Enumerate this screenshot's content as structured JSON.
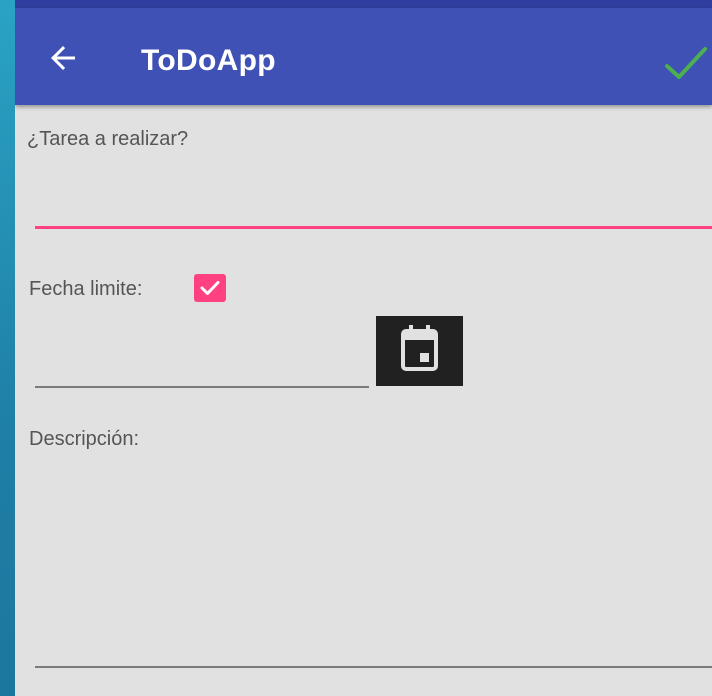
{
  "toolbar": {
    "title": "ToDoApp",
    "back_icon": "arrow-back-icon",
    "confirm_icon": "check-icon",
    "background_color": "#3f51b5",
    "confirm_color": "#4caf50"
  },
  "form": {
    "task": {
      "label": "¿Tarea a realizar?",
      "value": "",
      "accent_color": "#ff4081"
    },
    "deadline": {
      "label": "Fecha limite:",
      "checked": true,
      "date_value": "",
      "calendar_icon": "calendar-icon"
    },
    "description": {
      "label": "Descripción:",
      "value": ""
    }
  }
}
